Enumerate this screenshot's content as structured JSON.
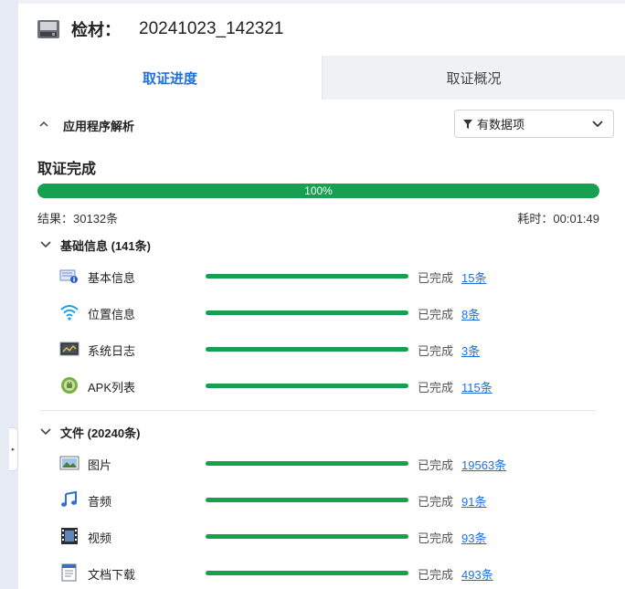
{
  "header": {
    "label": "检材：",
    "value": "20241023_142321",
    "icon": "disk-icon"
  },
  "tabs": [
    {
      "label": "取证进度",
      "active": true
    },
    {
      "label": "取证概况",
      "active": false
    }
  ],
  "section": {
    "title": "应用程序解析",
    "filter_label": "有数据项"
  },
  "status": {
    "title": "取证完成",
    "progress_percent": 100,
    "progress_label": "100%",
    "result": "结果：30132条",
    "elapsed": "耗时：00:01:49"
  },
  "groups": [
    {
      "title": "基础信息 (141条)",
      "items": [
        {
          "label": "基本信息",
          "status": "已完成",
          "count": "15条",
          "icon": "info-card-icon",
          "progress": 1.0
        },
        {
          "label": "位置信息",
          "status": "已完成",
          "count": "8条",
          "icon": "wifi-icon",
          "progress": 1.0
        },
        {
          "label": "系统日志",
          "status": "已完成",
          "count": "3条",
          "icon": "system-log-icon",
          "progress": 1.0
        },
        {
          "label": "APK列表",
          "status": "已完成",
          "count": "115条",
          "icon": "android-icon",
          "progress": 1.0
        }
      ]
    },
    {
      "title": "文件 (20240条)",
      "items": [
        {
          "label": "图片",
          "status": "已完成",
          "count": "19563条",
          "icon": "image-icon",
          "progress": 1.0
        },
        {
          "label": "音频",
          "status": "已完成",
          "count": "91条",
          "icon": "music-note-icon",
          "progress": 1.0
        },
        {
          "label": "视频",
          "status": "已完成",
          "count": "93条",
          "icon": "film-icon",
          "progress": 1.0
        },
        {
          "label": "文档下载",
          "status": "已完成",
          "count": "493条",
          "icon": "document-icon",
          "progress": 1.0
        }
      ]
    }
  ],
  "colors": {
    "accent": "#1f6fde",
    "progress": "#17a050",
    "sidebar": "#e6ebf5"
  }
}
